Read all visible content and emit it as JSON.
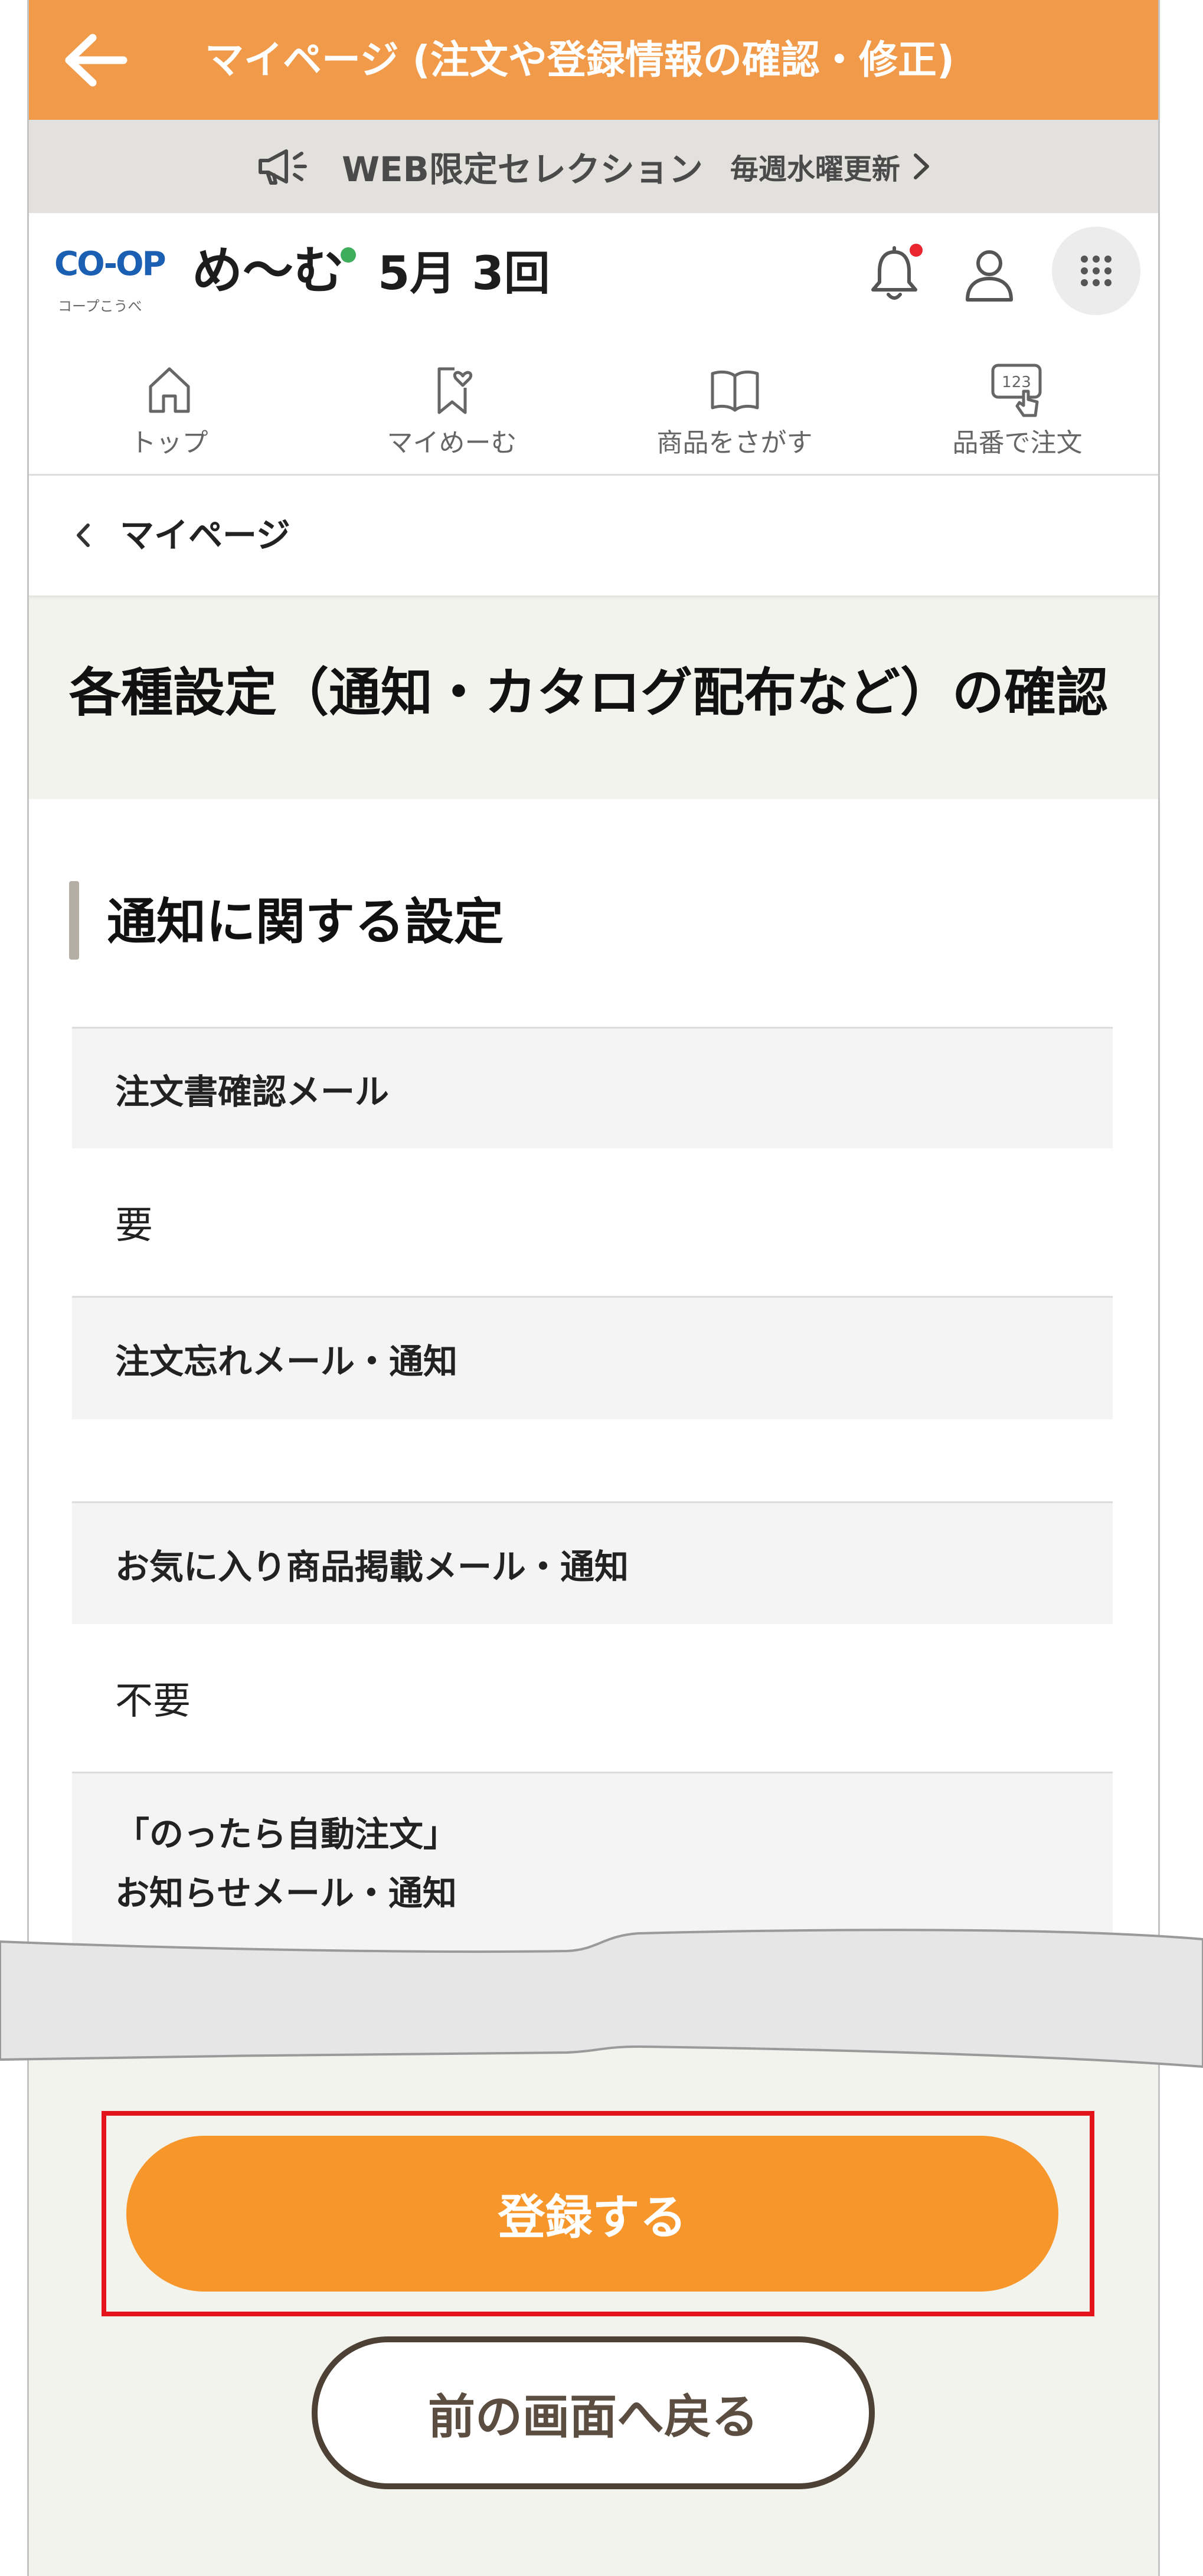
{
  "app_header": {
    "title": "マイページ (注文や登録情報の確認・修正)",
    "back_icon": "arrow-left-icon"
  },
  "banner": {
    "icon": "megaphone-icon",
    "main_text": "WEB限定セレクション",
    "sub_text": "毎週水曜更新",
    "chevron_icon": "chevron-right-icon"
  },
  "brand": {
    "logo_mark": "CO-OP",
    "logo_sub": "コープこうべ",
    "name": "め〜む",
    "issue": "5月 3回"
  },
  "header_icons": {
    "notifications": "bell-icon",
    "has_unread_notification": true,
    "account": "user-icon",
    "menu": "grid-menu-icon"
  },
  "nav": {
    "items": [
      {
        "label": "トップ",
        "icon": "home-icon"
      },
      {
        "label": "マイめーむ",
        "icon": "bookmark-heart-icon"
      },
      {
        "label": "商品をさがす",
        "icon": "book-icon"
      },
      {
        "label": "品番で注文",
        "icon": "number-tap-icon",
        "icon_text": "123"
      }
    ]
  },
  "breadcrumb": {
    "icon": "chevron-left-icon",
    "label": "マイページ"
  },
  "page_title": "各種設定（通知・カタログ配布など）の確認",
  "notification_settings": {
    "heading": "通知に関する設定",
    "rows": [
      {
        "label": "注文書確認メール",
        "value": "要"
      },
      {
        "label": "注文忘れメール・通知"
      },
      {
        "label": "お気に入り商品掲載メール・通知",
        "value": "不要"
      },
      {
        "label": "「のったら自動注文」\nお知らせメール・通知"
      }
    ]
  },
  "actions": {
    "submit_label": "登録する",
    "back_label": "前の画面へ戻る"
  },
  "colors": {
    "header_bg": "#f19a4a",
    "banner_bg": "#e3e1dd",
    "submit_button": "#f7962b",
    "highlight_border": "#e3141b",
    "notification_dot": "#e8262b",
    "brand_dot": "#3fae5c",
    "logo_blue": "#1b5fb3",
    "back_button_border": "#4d4135"
  }
}
